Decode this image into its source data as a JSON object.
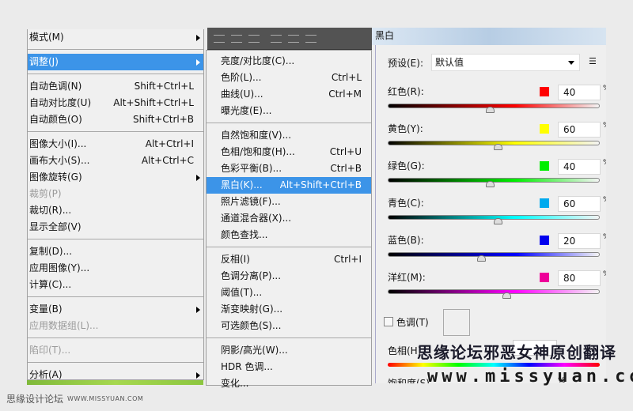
{
  "image_menu": {
    "items": [
      {
        "label": "模式(M)",
        "submenu": true
      },
      {
        "sep": true
      },
      {
        "label": "调整(J)",
        "submenu": true,
        "highlighted": true
      },
      {
        "sep": true
      },
      {
        "label": "自动色调(N)",
        "shortcut": "Shift+Ctrl+L"
      },
      {
        "label": "自动对比度(U)",
        "shortcut": "Alt+Shift+Ctrl+L"
      },
      {
        "label": "自动颜色(O)",
        "shortcut": "Shift+Ctrl+B"
      },
      {
        "sep": true
      },
      {
        "label": "图像大小(I)...",
        "shortcut": "Alt+Ctrl+I"
      },
      {
        "label": "画布大小(S)...",
        "shortcut": "Alt+Ctrl+C"
      },
      {
        "label": "图像旋转(G)",
        "submenu": true
      },
      {
        "label": "裁剪(P)",
        "disabled": true
      },
      {
        "label": "裁切(R)..."
      },
      {
        "label": "显示全部(V)"
      },
      {
        "sep": true
      },
      {
        "label": "复制(D)..."
      },
      {
        "label": "应用图像(Y)..."
      },
      {
        "label": "计算(C)..."
      },
      {
        "sep": true
      },
      {
        "label": "变量(B)",
        "submenu": true
      },
      {
        "label": "应用数据组(L)...",
        "disabled": true
      },
      {
        "sep": true
      },
      {
        "label": "陷印(T)...",
        "disabled": true
      },
      {
        "sep": true
      },
      {
        "label": "分析(A)",
        "submenu": true
      }
    ]
  },
  "adjust_menu": {
    "items": [
      {
        "label": "亮度/对比度(C)..."
      },
      {
        "label": "色阶(L)...",
        "shortcut": "Ctrl+L"
      },
      {
        "label": "曲线(U)...",
        "shortcut": "Ctrl+M"
      },
      {
        "label": "曝光度(E)..."
      },
      {
        "sep": true
      },
      {
        "label": "自然饱和度(V)..."
      },
      {
        "label": "色相/饱和度(H)...",
        "shortcut": "Ctrl+U"
      },
      {
        "label": "色彩平衡(B)...",
        "shortcut": "Ctrl+B"
      },
      {
        "label": "黑白(K)...",
        "shortcut": "Alt+Shift+Ctrl+B",
        "highlighted": true
      },
      {
        "label": "照片滤镜(F)..."
      },
      {
        "label": "通道混合器(X)..."
      },
      {
        "label": "颜色查找..."
      },
      {
        "sep": true
      },
      {
        "label": "反相(I)",
        "shortcut": "Ctrl+I"
      },
      {
        "label": "色调分离(P)..."
      },
      {
        "label": "阈值(T)..."
      },
      {
        "label": "渐变映射(G)..."
      },
      {
        "label": "可选颜色(S)..."
      },
      {
        "sep": true
      },
      {
        "label": "阴影/高光(W)..."
      },
      {
        "label": "HDR 色调..."
      },
      {
        "label": "变化..."
      }
    ]
  },
  "dialog": {
    "title": "黑白",
    "preset_label": "预设(E):",
    "preset_value": "默认值",
    "sliders": [
      {
        "label": "红色(R):",
        "value": "40",
        "swatch": "#ff0000",
        "from": "#000000",
        "to": "#ff0000"
      },
      {
        "label": "黄色(Y):",
        "value": "60",
        "swatch": "#ffff00",
        "from": "#000000",
        "to": "#ffff00"
      },
      {
        "label": "绿色(G):",
        "value": "40",
        "swatch": "#00ee00",
        "from": "#000000",
        "to": "#00ee00"
      },
      {
        "label": "青色(C):",
        "value": "60",
        "swatch": "#00aaee",
        "from": "#000000",
        "to": "#00ffff"
      },
      {
        "label": "蓝色(B):",
        "value": "20",
        "swatch": "#0000ee",
        "from": "#000000",
        "to": "#0000ff"
      },
      {
        "label": "洋红(M):",
        "value": "80",
        "swatch": "#ee0099",
        "from": "#000000",
        "to": "#ff00ff"
      }
    ],
    "slider_range": [
      -200,
      300
    ],
    "tint_label": "色调(T)",
    "hue_label": "色相(H)",
    "saturation_label": "饱和度(S)",
    "saturation_unit": "%",
    "percent_unit": "%"
  },
  "watermark": {
    "site_cn": "思缘设计论坛",
    "site_url": "WWW.MISSYUAN.COM",
    "overlay_cn": "思缘论坛邪恶女神原创翻译",
    "overlay_url": "www.missyuan.com"
  }
}
